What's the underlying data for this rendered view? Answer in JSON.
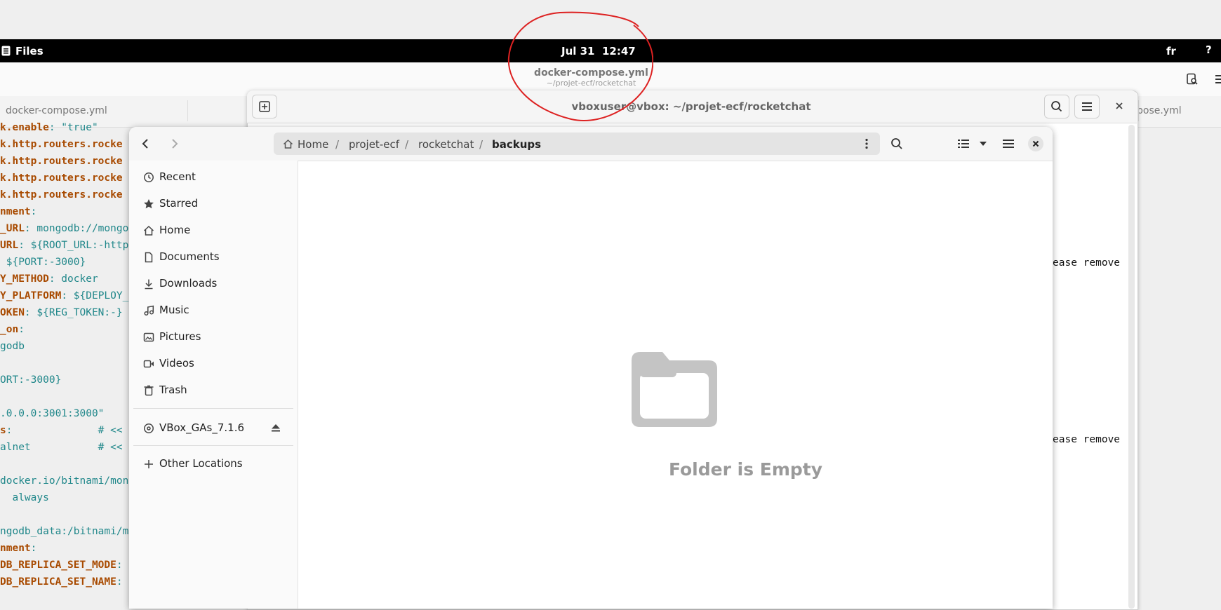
{
  "topbar": {
    "app_name": "Files",
    "datetime": "Jul 31  12:47",
    "keyboard_layout": "fr"
  },
  "editor": {
    "title": "docker-compose.yml",
    "subtitle": "~/projet-ecf/rocketchat",
    "tab_left": "docker-compose.yml",
    "tab_right": "pose.yml",
    "lines": [
      {
        "k": "k.enable",
        "v": ": \"true\""
      },
      {
        "k": "k.http.routers.rocke",
        "v": ""
      },
      {
        "k": "k.http.routers.rocke",
        "v": ""
      },
      {
        "k": "k.http.routers.rocke",
        "v": ""
      },
      {
        "k": "k.http.routers.rocke",
        "v": ""
      },
      {
        "k": "nment",
        "v": ":"
      },
      {
        "k": "_URL",
        "v": ": mongodb://mongo"
      },
      {
        "k": "URL",
        "v": ": ${ROOT_URL:-http"
      },
      {
        "k": "",
        "v": " ${PORT:-3000}"
      },
      {
        "k": "Y_METHOD",
        "v": ": docker"
      },
      {
        "k": "Y_PLATFORM",
        "v": ": ${DEPLOY_"
      },
      {
        "k": "OKEN",
        "v": ": ${REG_TOKEN:-}"
      },
      {
        "k": "_on",
        "v": ":"
      },
      {
        "k": "",
        "v": "godb"
      },
      {
        "k": "",
        "v": ""
      },
      {
        "k": "",
        "v": "ORT:-3000}"
      },
      {
        "k": "",
        "v": ""
      },
      {
        "k": "",
        "v": ".0.0.0:3001:3000\""
      },
      {
        "k": "s",
        "v": ":              # <<"
      },
      {
        "k": "",
        "v": "alnet           # <<"
      },
      {
        "k": "",
        "v": ""
      },
      {
        "k": "",
        "v": "docker.io/bitnami/mon"
      },
      {
        "k": "",
        "v": "  always"
      },
      {
        "k": "",
        "v": ""
      },
      {
        "k": "",
        "v": "ngodb_data:/bitnami/mo"
      },
      {
        "k": "nment",
        "v": ":"
      },
      {
        "k": "DB_REPLICA_SET_MODE",
        "v": ":"
      },
      {
        "k": "DB_REPLICA_SET_NAME",
        "v": ":"
      }
    ]
  },
  "terminal": {
    "title": "vboxuser@vbox: ~/projet-ecf/rocketchat",
    "line1": "ease remove",
    "line2": "ease remove"
  },
  "files": {
    "breadcrumb": [
      "Home",
      "projet-ecf",
      "rocketchat",
      "backups"
    ],
    "sidebar": [
      {
        "label": "Recent",
        "icon": "clock-icon"
      },
      {
        "label": "Starred",
        "icon": "star-icon"
      },
      {
        "label": "Home",
        "icon": "home-icon"
      },
      {
        "label": "Documents",
        "icon": "document-icon"
      },
      {
        "label": "Downloads",
        "icon": "download-icon"
      },
      {
        "label": "Music",
        "icon": "music-icon"
      },
      {
        "label": "Pictures",
        "icon": "picture-icon"
      },
      {
        "label": "Videos",
        "icon": "video-icon"
      },
      {
        "label": "Trash",
        "icon": "trash-icon"
      }
    ],
    "device": {
      "label": "VBox_GAs_7.1.6"
    },
    "other_locations": "Other Locations",
    "empty_message": "Folder is Empty"
  }
}
